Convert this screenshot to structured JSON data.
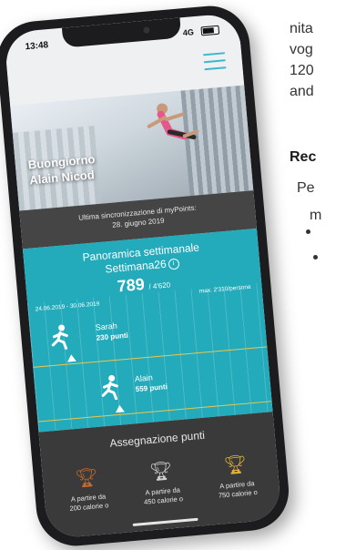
{
  "side": {
    "line1": "nita",
    "line2": "vog",
    "line3": "120",
    "line4": "and",
    "heading": "Rec",
    "line5": "Pe",
    "line6": "m"
  },
  "status": {
    "time": "13:48",
    "signal": "4G"
  },
  "hero": {
    "greeting_line1": "Buongiorno",
    "greeting_line2": "Alain Nicod"
  },
  "sync": {
    "line1": "Ultima sincronizzazione di myPoints:",
    "line2": "28. giugno 2019"
  },
  "weekly": {
    "title": "Panoramica settimanale",
    "week": "Settimana26",
    "info_icon": "info-icon",
    "points": "789",
    "total": "/ 4'620",
    "range": "24.06.2019 - 30.06.2019",
    "max": "max. 2'310/persona",
    "participants": [
      {
        "name": "Sarah",
        "points": "230 punti",
        "value": 230
      },
      {
        "name": "Alain",
        "points": "559 punti",
        "value": 559
      }
    ]
  },
  "assign": {
    "title": "Assegnazione punti",
    "tiers": [
      {
        "label1": "A partire da",
        "label2": "200 calorie o",
        "color": "#c8692d"
      },
      {
        "label1": "A partire da",
        "label2": "450 calorie o",
        "color": "#d0d0d0"
      },
      {
        "label1": "A partire da",
        "label2": "750 calorie o",
        "color": "#e0b43a"
      }
    ]
  },
  "colors": {
    "accent": "#23aabb",
    "track": "#f2c64a",
    "dark": "#3a3a3a"
  }
}
